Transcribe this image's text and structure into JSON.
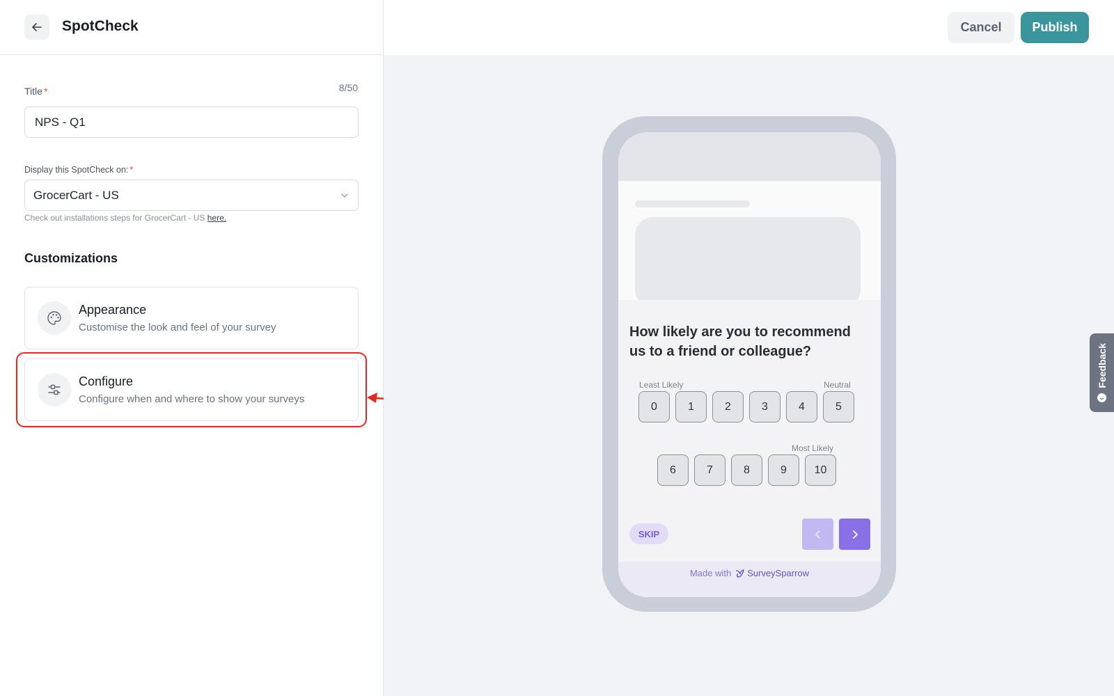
{
  "header": {
    "title": "SpotCheck",
    "back_icon": "arrow-left-icon"
  },
  "actions": {
    "cancel_label": "Cancel",
    "publish_label": "Publish"
  },
  "form": {
    "title_label": "Title",
    "title_value": "NPS - Q1",
    "title_counter": "8/50",
    "display_label": "Display this SpotCheck on:",
    "display_value": "GrocerCart - US",
    "help_prefix": "Check out installations steps for GrocerCart - US ",
    "help_link": "here."
  },
  "customizations": {
    "heading": "Customizations",
    "items": [
      {
        "title": "Appearance",
        "subtitle": "Customise the look and feel of your survey",
        "icon": "palette-icon"
      },
      {
        "title": "Configure",
        "subtitle": "Configure when and where to show your surveys",
        "icon": "sliders-icon"
      }
    ]
  },
  "preview": {
    "question": "How likely are you to recommend us to a friend or colleague?",
    "least_label": "Least Likely",
    "neutral_label": "Neutral",
    "most_label": "Most Likely",
    "scale_row1": [
      "0",
      "1",
      "2",
      "3",
      "4",
      "5"
    ],
    "scale_row2": [
      "6",
      "7",
      "8",
      "9",
      "10"
    ],
    "skip_label": "SKIP",
    "made_with_prefix": "Made with",
    "brand_name": "SurveySparrow"
  },
  "feedback_tab_label": "Feedback",
  "colors": {
    "primary": "#3a959c",
    "highlight": "#e8271f",
    "survey_accent": "#8a70e6"
  }
}
